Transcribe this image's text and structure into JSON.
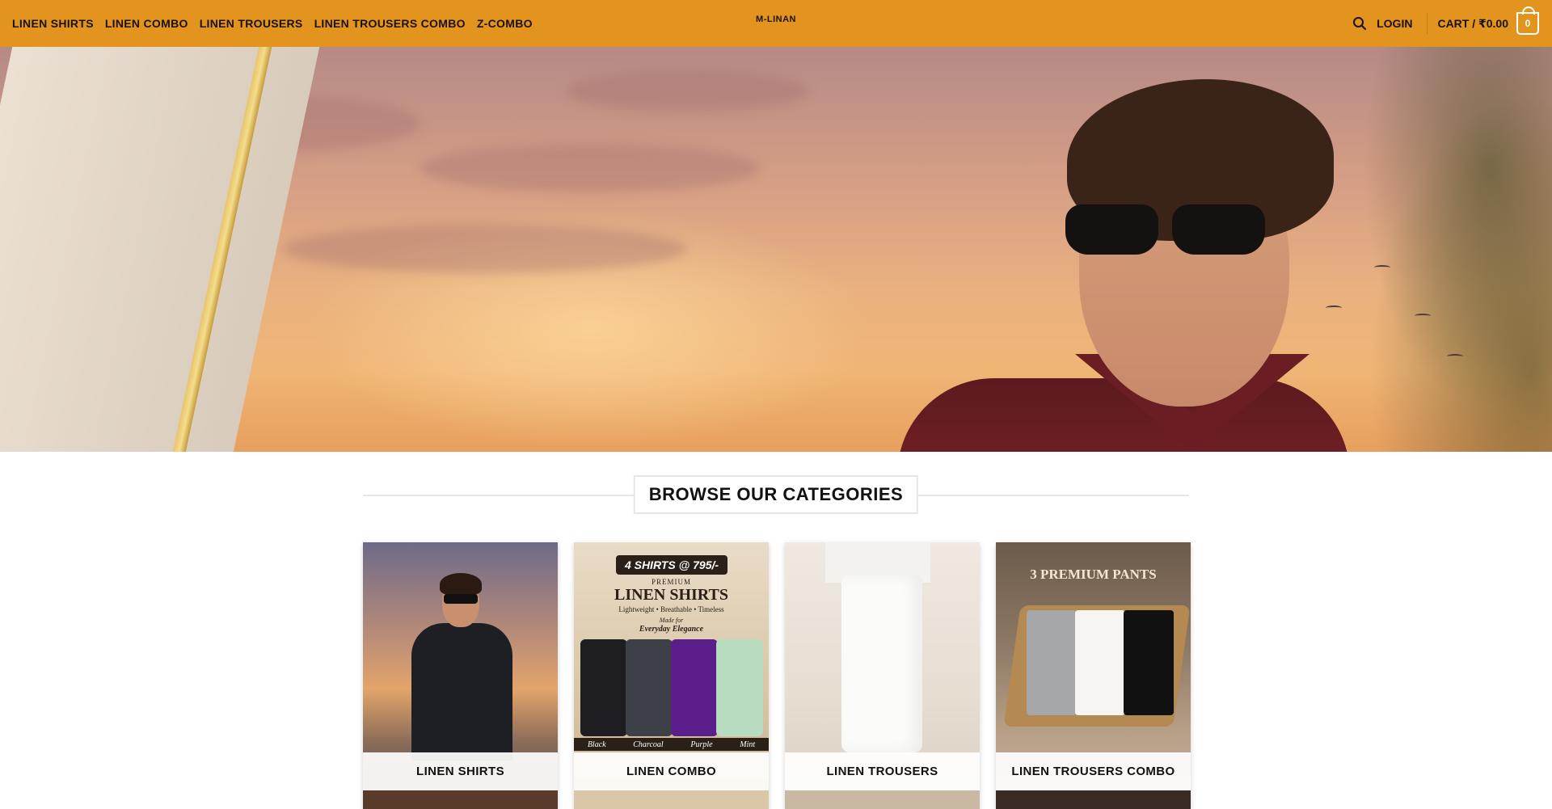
{
  "nav": {
    "items": [
      {
        "label": "LINEN SHIRTS"
      },
      {
        "label": "LINEN COMBO"
      },
      {
        "label": "LINEN TROUSERS"
      },
      {
        "label": "LINEN TROUSERS COMBO"
      },
      {
        "label": "Z-COMBO"
      }
    ],
    "logo": "M-LINAN",
    "login": "LOGIN",
    "cart_label": "CART / ₹0.00",
    "cart_count": "0"
  },
  "icons": {
    "search": "search-icon",
    "cart": "cart-icon"
  },
  "colors": {
    "header_bg": "#e2941f",
    "text": "#1a1208"
  },
  "section": {
    "title": "BROWSE OUR CATEGORIES"
  },
  "categories": [
    {
      "label": "LINEN SHIRTS"
    },
    {
      "label": "LINEN COMBO",
      "promo": "4 SHIRTS @ 795/-",
      "sub_premium": "PREMIUM",
      "sub_title": "LINEN SHIRTS",
      "tagline": "Lightweight • Breathable • Timeless",
      "made_for": "Made for",
      "elegance": "Everyday Elegance",
      "colors": [
        "Black",
        "Charcoal",
        "Purple",
        "Mint"
      ]
    },
    {
      "label": "LINEN TROUSERS"
    },
    {
      "label": "LINEN TROUSERS COMBO",
      "promo": "3 PREMIUM PANTS"
    }
  ]
}
